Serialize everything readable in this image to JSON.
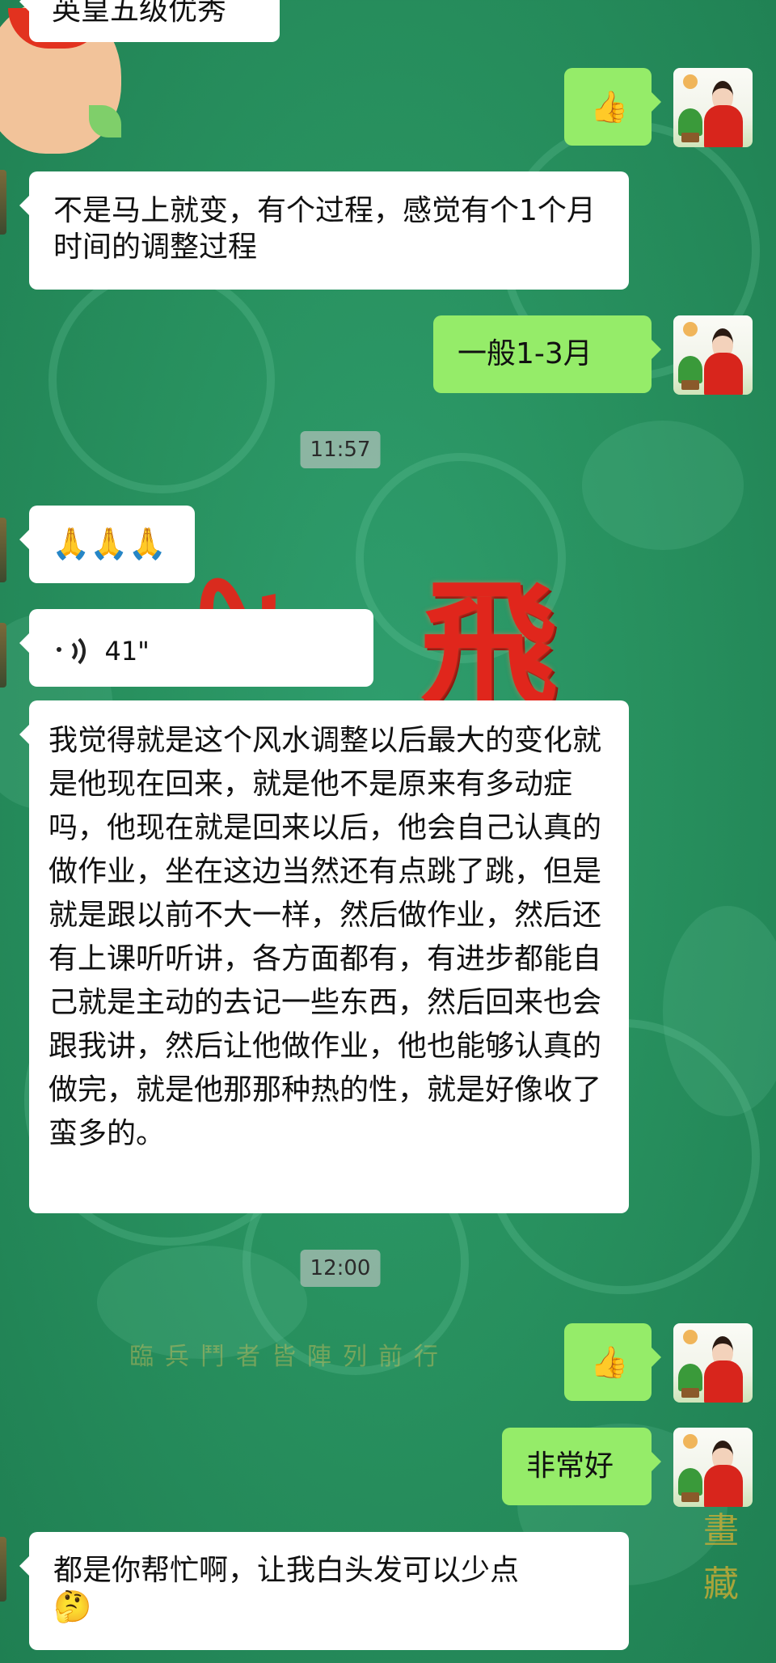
{
  "colors": {
    "background": "#28915f",
    "incoming_bubble": "#ffffff",
    "outgoing_bubble": "#95ec69"
  },
  "background_art": {
    "seal_char": "飛",
    "verse": "臨兵鬥者皆陣列前行",
    "stamp": "畫藏"
  },
  "messages": [
    {
      "id": "m0",
      "side": "in",
      "text": "英皇五级优秀"
    },
    {
      "id": "m1",
      "side": "out",
      "icon": "thumbs-up-icon",
      "glyph": "👍"
    },
    {
      "id": "m2",
      "side": "in",
      "text": "不是马上就变，有个过程，感觉有个1个月时间的调整过程"
    },
    {
      "id": "m3",
      "side": "out",
      "text": "一般1-3月"
    },
    {
      "id": "t1",
      "type": "timestamp",
      "text": "11:57"
    },
    {
      "id": "m4",
      "side": "in",
      "icon": "praying-hands-icon",
      "glyph": "🙏🙏🙏"
    },
    {
      "id": "m5",
      "side": "in",
      "type": "voice",
      "icon": "voice-wave-icon",
      "duration": "41\""
    },
    {
      "id": "m6",
      "side": "in",
      "text": "我觉得就是这个风水调整以后最大的变化就是他现在回来，就是他不是原来有多动症吗，他现在就是回来以后，他会自己认真的做作业，坐在这边当然还有点跳了跳，但是就是跟以前不大一样，然后做作业，然后还有上课听听讲，各方面都有，有进步都能自己就是主动的去记一些东西，然后回来也会跟我讲，然后让他做作业，他也能够认真的做完，就是他那那种热的性，就是好像收了蛮多的。"
    },
    {
      "id": "t2",
      "type": "timestamp",
      "text": "12:00"
    },
    {
      "id": "m7",
      "side": "out",
      "icon": "thumbs-up-icon",
      "glyph": "👍"
    },
    {
      "id": "m8",
      "side": "out",
      "text": "非常好"
    },
    {
      "id": "m9",
      "side": "in",
      "text": "都是你帮忙啊，让我白头发可以少点",
      "emoji": "🤔",
      "icon": "thinking-face-icon"
    }
  ]
}
